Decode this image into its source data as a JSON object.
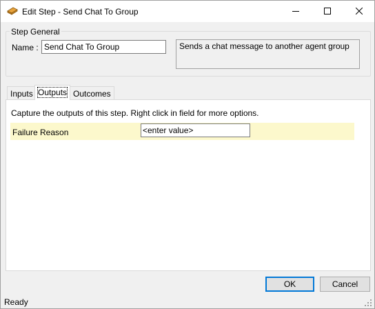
{
  "window": {
    "title": "Edit Step - Send Chat To Group",
    "icon": "step-icon",
    "controls": {
      "minimize": "minimize-icon",
      "maximize": "maximize-icon",
      "close": "close-icon"
    }
  },
  "step_general": {
    "legend": "Step General",
    "name_label": "Name :",
    "name_value": "Send Chat To Group",
    "description": "Sends a chat message to another agent group"
  },
  "tabs": [
    {
      "label": "Inputs",
      "active": false
    },
    {
      "label": "Outputs",
      "active": true
    },
    {
      "label": "Outcomes",
      "active": false
    }
  ],
  "outputs": {
    "instructions": "Capture the outputs of this step.  Right click in field for more options.",
    "fields": [
      {
        "label": "Failure Reason",
        "value": "<enter value>"
      }
    ],
    "row_highlight": "#fcf8cc"
  },
  "buttons": {
    "ok": "OK",
    "cancel": "Cancel"
  },
  "status": {
    "text": "Ready"
  },
  "colors": {
    "accent": "#0078d7",
    "window_bg": "#f0f0f0"
  }
}
